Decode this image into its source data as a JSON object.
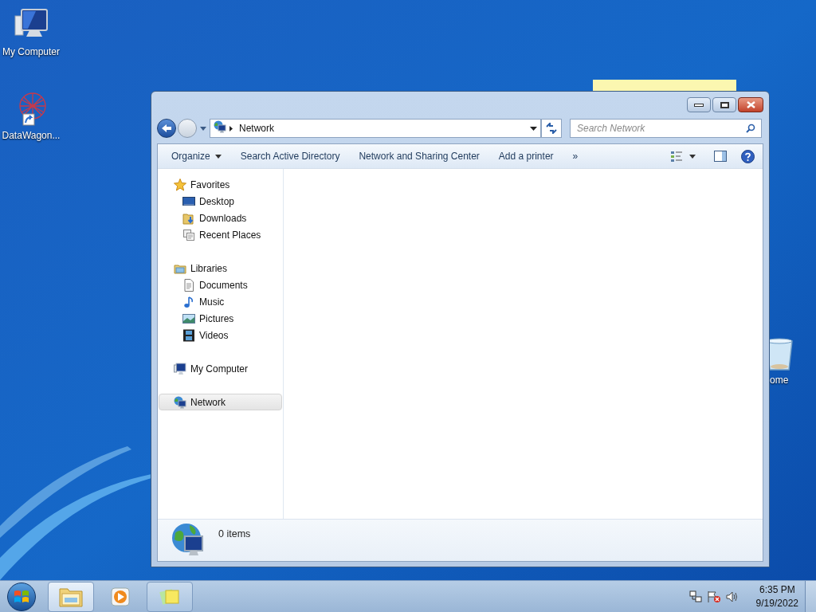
{
  "desktop_icons": [
    {
      "label": "My Computer",
      "kind": "computer"
    },
    {
      "label": "DataWagon...",
      "kind": "shortcut"
    },
    {
      "label": "ome",
      "kind": "recycle"
    }
  ],
  "window": {
    "address": {
      "path": [
        "Network"
      ]
    },
    "search": {
      "placeholder": "Search Network"
    },
    "toolbar": [
      {
        "label": "Organize",
        "kind": "menu"
      },
      {
        "label": "Search Active Directory",
        "kind": "command"
      },
      {
        "label": "Network and Sharing Center",
        "kind": "command"
      },
      {
        "label": "Add a printer",
        "kind": "command"
      },
      {
        "label": "»",
        "kind": "command"
      }
    ],
    "nav": [
      {
        "label": "Favorites",
        "kind": "star",
        "selected": false,
        "children": [
          {
            "label": "Desktop",
            "kind": "desktop",
            "selected": false
          },
          {
            "label": "Downloads",
            "kind": "downloads",
            "selected": false
          },
          {
            "label": "Recent Places",
            "kind": "recent",
            "selected": false
          }
        ]
      },
      {
        "label": "Libraries",
        "kind": "library",
        "selected": false,
        "children": [
          {
            "label": "Documents",
            "kind": "documents",
            "selected": false
          },
          {
            "label": "Music",
            "kind": "music",
            "selected": false
          },
          {
            "label": "Pictures",
            "kind": "pictures",
            "selected": false
          },
          {
            "label": "Videos",
            "kind": "videos",
            "selected": false
          }
        ]
      },
      {
        "label": "My Computer",
        "kind": "computer",
        "selected": false
      },
      {
        "label": "Network",
        "kind": "network",
        "selected": true
      }
    ],
    "details": {
      "count": "0 items"
    }
  },
  "taskbar": {
    "apps": [
      {
        "kind": "explorer",
        "selected": true,
        "running": true
      },
      {
        "kind": "media",
        "selected": false,
        "running": false
      },
      {
        "kind": "notes",
        "selected": false,
        "running": true
      }
    ],
    "clock": {
      "time": "6:35 PM",
      "date": "9/19/2022"
    }
  }
}
